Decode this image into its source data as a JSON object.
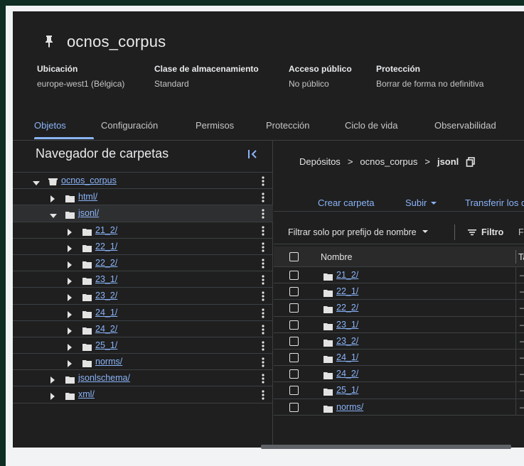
{
  "bucket": {
    "name": "ocnos_corpus",
    "meta": [
      {
        "label": "Ubicación",
        "value": "europe-west1 (Bélgica)"
      },
      {
        "label": "Clase de almacenamiento",
        "value": "Standard"
      },
      {
        "label": "Acceso público",
        "value": "No público"
      },
      {
        "label": "Protección",
        "value": "Borrar de forma no definitiva"
      }
    ]
  },
  "tabs": [
    {
      "label": "Objetos",
      "active": true
    },
    {
      "label": "Configuración"
    },
    {
      "label": "Permisos"
    },
    {
      "label": "Protección"
    },
    {
      "label": "Ciclo de vida"
    },
    {
      "label": "Observabilidad"
    }
  ],
  "browser": {
    "title": "Navegador de carpetas",
    "tree": [
      {
        "name": "ocnos_corpus",
        "level": 0,
        "expanded": true,
        "type": "bucket"
      },
      {
        "name": "html/",
        "level": 1,
        "expanded": false
      },
      {
        "name": "jsonl/",
        "level": 1,
        "expanded": true,
        "selected": true
      },
      {
        "name": "21_2/",
        "level": 2
      },
      {
        "name": "22_1/",
        "level": 2
      },
      {
        "name": "22_2/",
        "level": 2
      },
      {
        "name": "23_1/",
        "level": 2
      },
      {
        "name": "23_2/",
        "level": 2
      },
      {
        "name": "24_1/",
        "level": 2
      },
      {
        "name": "24_2/",
        "level": 2
      },
      {
        "name": "25_1/",
        "level": 2
      },
      {
        "name": "norms/",
        "level": 2
      },
      {
        "name": "jsonlschema/",
        "level": 1
      },
      {
        "name": "xml/",
        "level": 1
      }
    ]
  },
  "breadcrumb": {
    "root": "Depósitos",
    "bucket": "ocnos_corpus",
    "current": "jsonl",
    "sep": ">"
  },
  "actions": {
    "create_folder": "Crear carpeta",
    "upload": "Subir",
    "transfer": "Transferir los da"
  },
  "filter": {
    "prefix": "Filtrar solo por prefijo de nombre",
    "filter_label": "Filtro",
    "extra": "Fi"
  },
  "table": {
    "col_name": "Nombre",
    "col_size": "Ta",
    "rows": [
      "21_2/",
      "22_1/",
      "22_2/",
      "23_1/",
      "23_2/",
      "24_1/",
      "24_2/",
      "25_1/",
      "norms/"
    ],
    "dash": "—"
  },
  "colors": {
    "background": "#1f1f1f",
    "link": "#8ab4f8",
    "text": "#e3e3e3",
    "frame": "#0f2d22"
  }
}
